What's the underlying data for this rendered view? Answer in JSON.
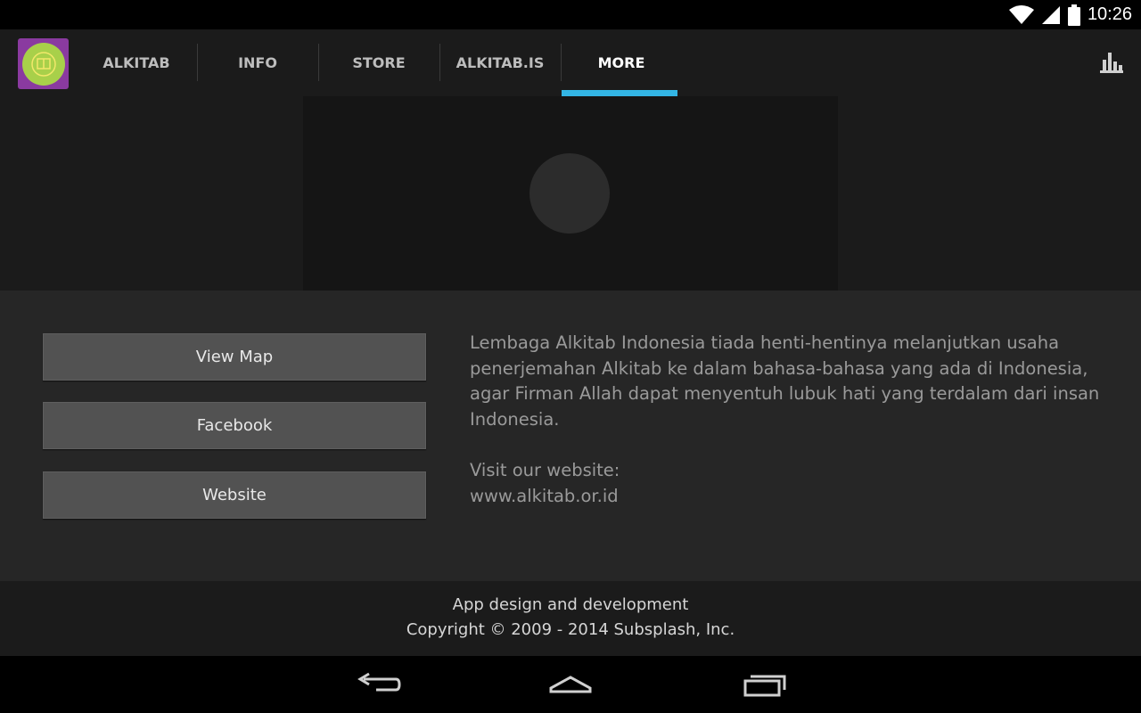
{
  "status_bar": {
    "time": "10:26",
    "icons": [
      "wifi-icon",
      "cellular-signal-icon",
      "battery-icon"
    ]
  },
  "action_bar": {
    "app_icon": "alkitab-app-icon",
    "tabs": [
      {
        "label": "ALKITAB",
        "active": false
      },
      {
        "label": "INFO",
        "active": false
      },
      {
        "label": "STORE",
        "active": false
      },
      {
        "label": "ALKITAB.IS",
        "active": false
      },
      {
        "label": "MORE",
        "active": true
      }
    ],
    "right_icon": "bar-chart-icon",
    "accent_color": "#33b5e5"
  },
  "hero": {
    "loading_indicator": "loading-placeholder"
  },
  "buttons": {
    "view_map": "View Map",
    "facebook": "Facebook",
    "website": "Website"
  },
  "description": {
    "text": "Lembaga Alkitab Indonesia tiada henti-hentinya melanjutkan usaha penerjemahan Alkitab ke dalam bahasa-bahasa yang ada di Indonesia, agar Firman Allah dapat menyentuh lubuk hati yang terdalam dari insan Indonesia.",
    "visit_label": "Visit our website:",
    "website_url": "www.alkitab.or.id"
  },
  "footer": {
    "line1": "App design and development",
    "line2": "Copyright © 2009 - 2014 Subsplash, Inc."
  },
  "nav_bar": {
    "icons": [
      "back-icon",
      "home-icon",
      "recent-apps-icon"
    ]
  }
}
